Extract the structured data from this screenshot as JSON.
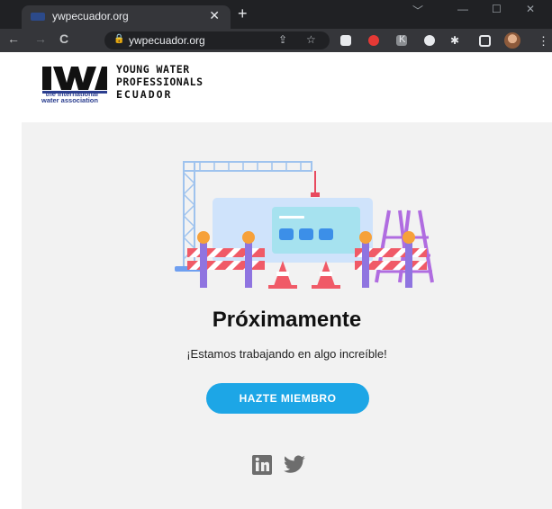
{
  "browser": {
    "tab_title": "ywpecuador.org",
    "tab_close": "✕",
    "new_tab": "+",
    "url": "ywpecuador.org",
    "window_controls": [
      "﹀",
      "—",
      "☐",
      "✕"
    ],
    "nav": {
      "back": "←",
      "forward": "→",
      "reload": "C"
    },
    "extensions": [
      "youtube-icon",
      "red-icon",
      "k-icon",
      "extension-icon",
      "puzzle-icon",
      "sidepanel-icon"
    ],
    "extension_k_label": "K",
    "menu_icon": "⋮"
  },
  "site": {
    "logo_mark": "IWA",
    "logo_sub": [
      "the international",
      "water association"
    ],
    "logo_text": [
      "YOUNG WATER",
      "PROFESSIONALS",
      "ECUADOR"
    ]
  },
  "main": {
    "title": "Próximamente",
    "subtitle": "¡Estamos trabajando en algo increíble!",
    "cta_label": "HAZTE MIEMBRO",
    "social": [
      "linkedin-icon",
      "twitter-icon"
    ]
  },
  "colors": {
    "accent": "#1da6e6",
    "background": "#f2f2f2",
    "logo_blue": "#2b3e8f"
  }
}
